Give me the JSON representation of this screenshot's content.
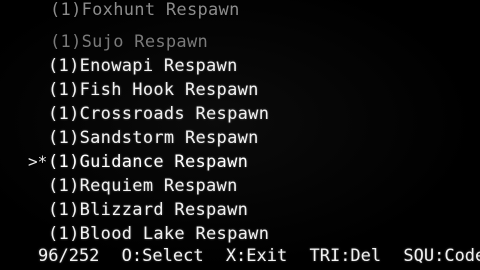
{
  "menu": {
    "items": [
      {
        "count": "(1)",
        "name": "Foxhunt Respawn"
      },
      {
        "count": "(1)",
        "name": "Sujo Respawn"
      },
      {
        "count": "(1)",
        "name": "Enowapi Respawn"
      },
      {
        "count": "(1)",
        "name": "Fish Hook Respawn"
      },
      {
        "count": "(1)",
        "name": "Crossroads Respawn"
      },
      {
        "count": "(1)",
        "name": "Sandstorm Respawn"
      },
      {
        "count": "(1)",
        "name": "Guidance Respawn"
      },
      {
        "count": "(1)",
        "name": "Requiem Respawn"
      },
      {
        "count": "(1)",
        "name": "Blizzard Respawn"
      },
      {
        "count": "(1)",
        "name": "Blood Lake Respawn"
      }
    ],
    "cursor": ">*"
  },
  "footer": {
    "position": "96/252",
    "select": "O:Select",
    "exit": "X:Exit",
    "delete": "TRI:Del",
    "code": "SQU:Code"
  },
  "colors": {
    "background": "#000000",
    "text": "#f2f2f2",
    "dim_text": "#8c8c8c"
  }
}
